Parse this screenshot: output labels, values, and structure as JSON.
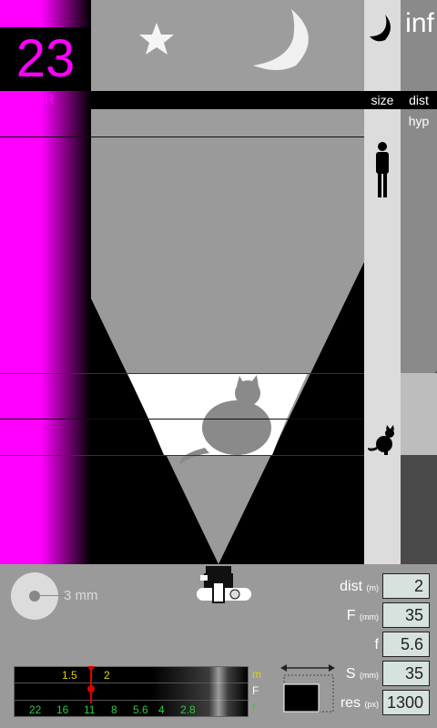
{
  "blur": {
    "value": "23",
    "label": "BLUR"
  },
  "columns": {
    "size_label": "size",
    "dist_label": "dist",
    "hyp_label": "hyp",
    "inf_label": "inf"
  },
  "focal": {
    "value_text": "3 mm"
  },
  "fields": [
    {
      "label": "dist",
      "unit": "(m)",
      "value": "2"
    },
    {
      "label": "F",
      "unit": "(mm)",
      "value": "35"
    },
    {
      "label": "f",
      "unit": "",
      "value": "5.6"
    },
    {
      "label": "S",
      "unit": "(mm)",
      "value": "35"
    },
    {
      "label": "res",
      "unit": "(px)",
      "value": "1300"
    }
  ],
  "scale": {
    "distance_marks": [
      "1.5",
      "2"
    ],
    "fstop_marks": [
      "22",
      "16",
      "11",
      "8",
      "5.6",
      "4",
      "2.8"
    ],
    "row_letters": [
      "m",
      "F",
      "f"
    ]
  },
  "colors": {
    "magenta": "#ff00ff",
    "scale_yellow": "#e6d200",
    "scale_green": "#2ecc40",
    "marker_red": "#e00000"
  }
}
